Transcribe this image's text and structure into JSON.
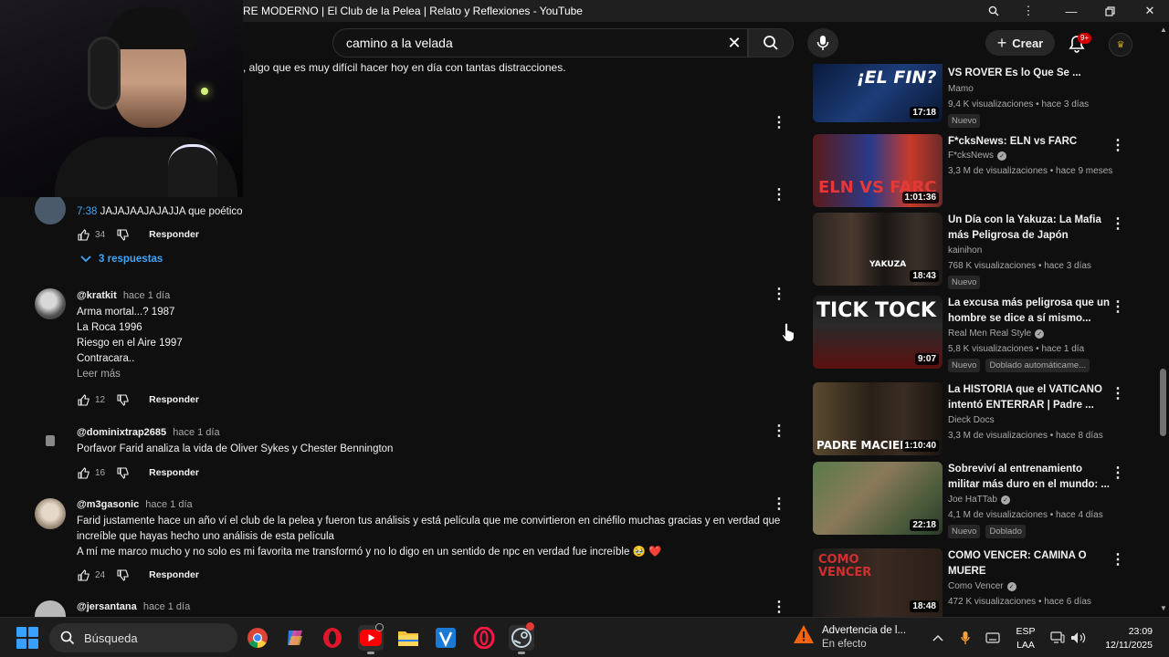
{
  "window": {
    "title": "RE MODERNO | El Club de la Pelea | Relato y Reflexiones - YouTube"
  },
  "header": {
    "search_value": "camino a la velada",
    "create_label": "Crear",
    "notification_count": "9+"
  },
  "comments": {
    "fragment_text": ", algo que es muy difícil hacer hoy en día con tantas distracciones.",
    "items": [
      {
        "author": "",
        "time": "",
        "timestamp_link": "7:38",
        "lines": [
          "JAJAJAAJAJAJJA que poético"
        ],
        "likes": "34",
        "reply_label": "Responder",
        "replies_label": "3 respuestas"
      },
      {
        "author": "@kratkit",
        "time": "hace 1 día",
        "lines": [
          "Arma mortal...? 1987",
          "La Roca 1996",
          "Riesgo en el Aire 1997",
          "Contracara.."
        ],
        "read_more": "Leer más",
        "likes": "12",
        "reply_label": "Responder"
      },
      {
        "author": "@dominixtrap2685",
        "time": "hace 1 día",
        "lines": [
          "Porfavor Farid analiza la vida de Oliver Sykes y Chester Bennington"
        ],
        "likes": "16",
        "reply_label": "Responder"
      },
      {
        "author": "@m3gasonic",
        "time": "hace 1 día",
        "lines": [
          "Farid justamente hace un año ví el club de la pelea y fueron tus análisis y está película que me convirtieron en cinéfilo muchas gracias y en verdad que",
          "increíble que hayas hecho uno análisis de esta película",
          "A mí me marco mucho y no solo es mi favorita me transformó y no lo digo en un sentido de npc en verdad fue increíble 🥹 ❤️"
        ],
        "likes": "24",
        "reply_label": "Responder"
      },
      {
        "author": "@jersantana",
        "time": "hace 1 día"
      }
    ]
  },
  "sidebar": {
    "items": [
      {
        "title_line2": "VS ROVER Es lo Que Se ...",
        "thumb_text": "¡EL FIN?",
        "duration": "17:18",
        "channel": "Mamo",
        "meta": "9,4 K visualizaciones • hace 3 días",
        "badges": [
          "Nuevo"
        ]
      },
      {
        "title": "F*cksNews: ELN vs FARC",
        "thumb_text": "ELN VS FARC",
        "duration": "1:01:36",
        "channel": "F*cksNews",
        "verified": true,
        "meta": "3,3 M de visualizaciones • hace 9 meses"
      },
      {
        "title": "Un Día con la Yakuza: La Mafia más Peligrosa de Japón",
        "thumb_text": "YAKUZA",
        "duration": "18:43",
        "channel": "kainihon",
        "meta": "768 K visualizaciones • hace 3 días",
        "badges": [
          "Nuevo"
        ]
      },
      {
        "title": "La excusa más peligrosa que un hombre se dice a sí mismo...",
        "thumb_text": "TICK TOCK",
        "duration": "9:07",
        "channel": "Real Men Real Style",
        "verified": true,
        "meta": "5,8 K visualizaciones • hace 1 día",
        "badges": [
          "Nuevo",
          "Doblado automáticame..."
        ]
      },
      {
        "title": "La HISTORIA que el VATICANO intentó ENTERRAR | Padre ...",
        "thumb_text": "PADRE MACIEL",
        "duration": "1:10:40",
        "channel": "Dieck Docs",
        "meta": "3,3 M de visualizaciones • hace 8 días"
      },
      {
        "title": "Sobreviví al entrenamiento militar más duro en el mundo: ...",
        "duration": "22:18",
        "channel": "Joe HaTTab",
        "verified": true,
        "meta": "4,1 M de visualizaciones • hace 4 días",
        "badges": [
          "Nuevo",
          "Doblado"
        ]
      },
      {
        "title": "COMO VENCER: CAMINA O MUERE",
        "thumb_text": "COMO VENCER",
        "duration": "18:48",
        "channel": "Como Vencer",
        "verified": true,
        "meta": "472 K visualizaciones • hace 6 días"
      }
    ]
  },
  "taskbar": {
    "search_label": "Búsqueda",
    "weather_title": "Advertencia de l...",
    "weather_sub": "En efecto",
    "lang_line1": "ESP",
    "lang_line2": "LAA",
    "time": "23:09",
    "date": "12/11/2025"
  },
  "colors": {
    "background": "#0f0f0f",
    "link_blue": "#3ea6ff",
    "notification_red": "#cc0000",
    "warning_orange": "#f7630c"
  }
}
